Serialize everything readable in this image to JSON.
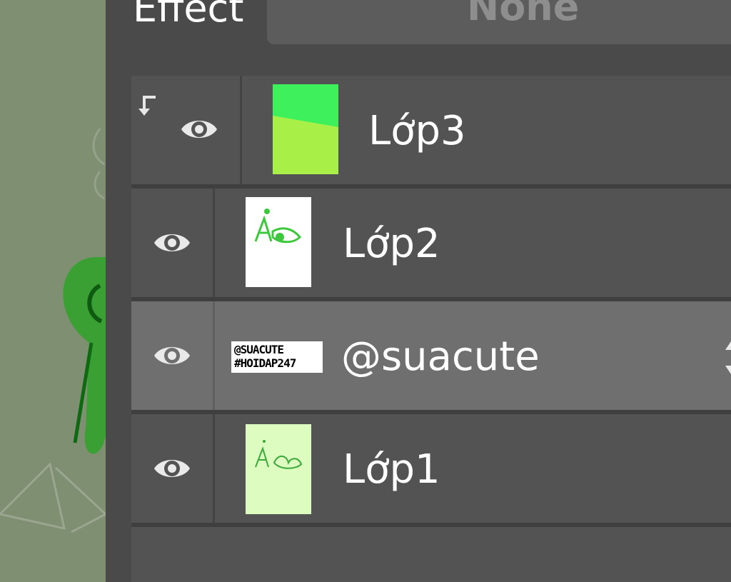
{
  "effect": {
    "label": "Effect",
    "value": "None"
  },
  "layers": [
    {
      "name": "Lớp3",
      "visible": true,
      "clipped": true,
      "selected": false,
      "thumbnail": "green-gradient"
    },
    {
      "name": "Lớp2",
      "visible": true,
      "clipped": false,
      "selected": false,
      "thumbnail": "green-sketch-on-white"
    },
    {
      "name": "@suacute",
      "visible": true,
      "clipped": false,
      "selected": true,
      "thumbnail": "text-watermark",
      "thumbnail_text": [
        "@SUACUTE",
        "#HOIDAP247"
      ]
    },
    {
      "name": "Lớp1",
      "visible": true,
      "clipped": false,
      "selected": false,
      "thumbnail": "green-sketch-on-light-green"
    }
  ],
  "icons": {
    "visibility": "eye-icon",
    "clipping": "clip-arrow-icon",
    "drag": "drag-handle-icon"
  },
  "colors": {
    "panel": "#4a4a4a",
    "layer_row": "#535353",
    "selected_row": "#6f6f6f",
    "canvas": "#7f8f72"
  }
}
